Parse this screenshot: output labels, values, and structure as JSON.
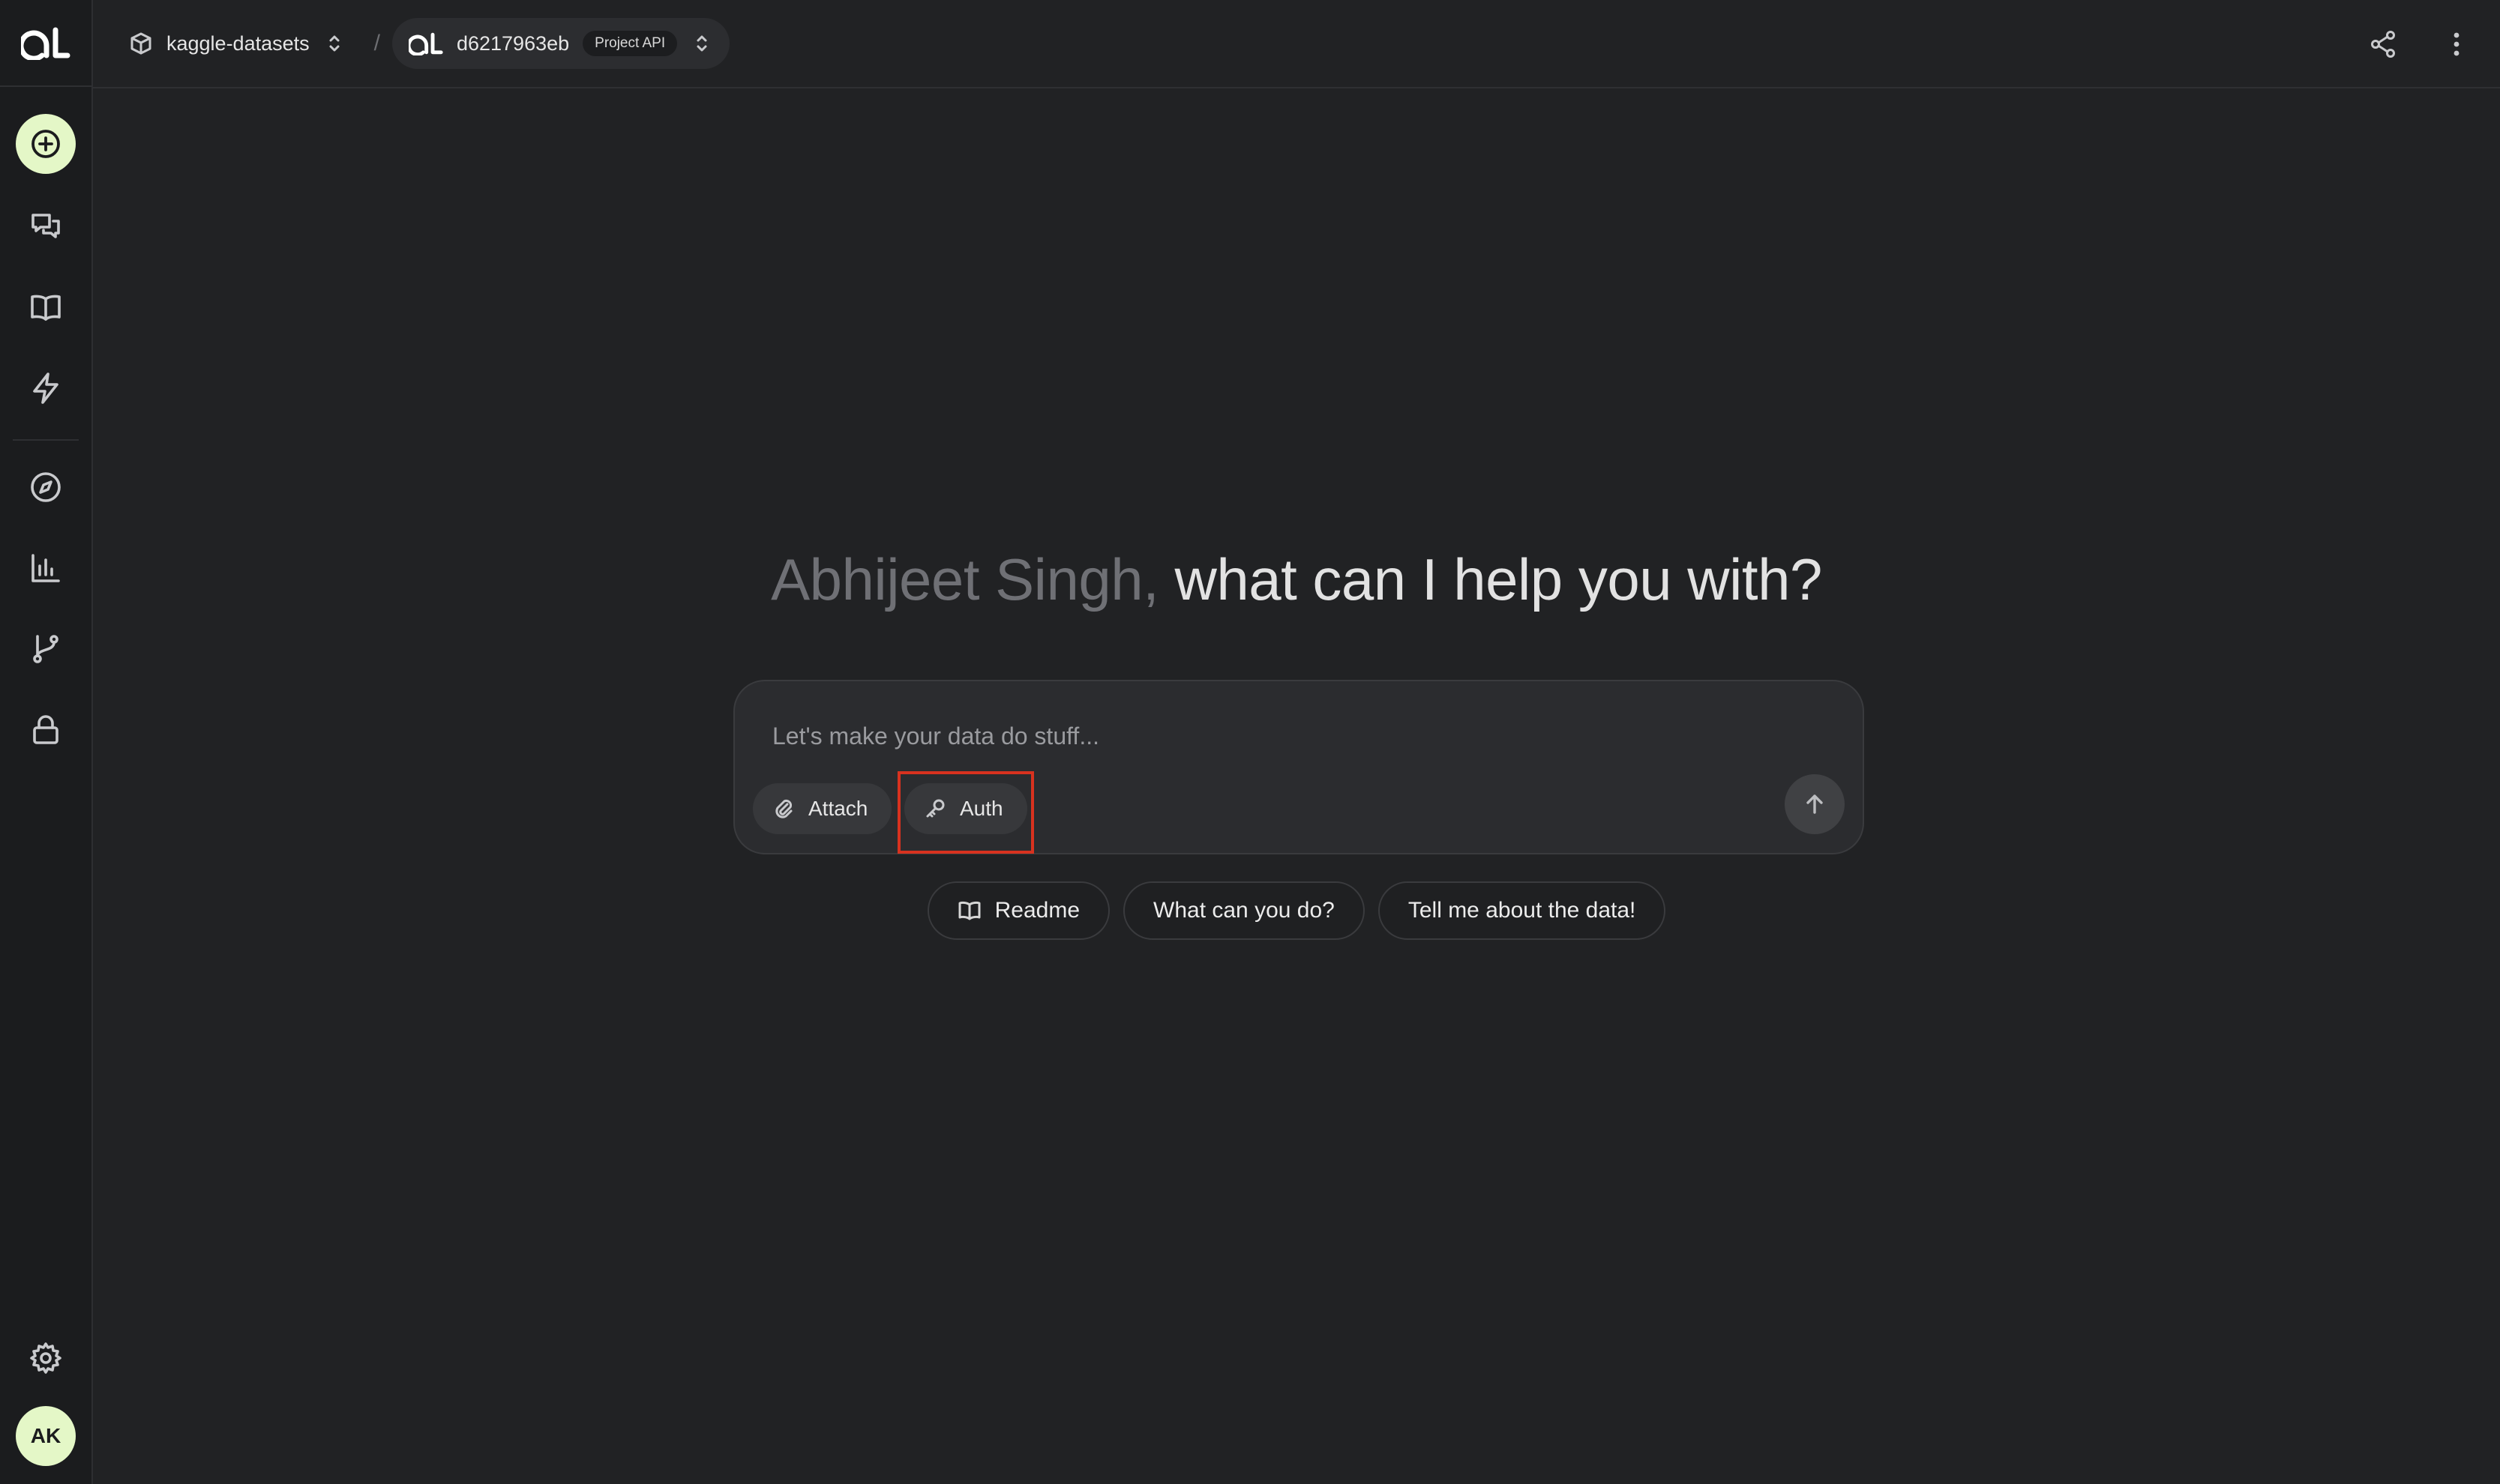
{
  "breadcrumb": {
    "workspace": "kaggle-datasets",
    "separator": "/",
    "project_id": "d6217963eb",
    "project_badge": "Project API"
  },
  "sidebar": {
    "items": [
      {
        "name": "new-chat",
        "icon": "plus-circle-icon"
      },
      {
        "name": "chats",
        "icon": "chat-bubbles-icon"
      },
      {
        "name": "docs",
        "icon": "book-open-icon"
      },
      {
        "name": "actions",
        "icon": "lightning-icon"
      },
      {
        "name": "explore",
        "icon": "compass-icon"
      },
      {
        "name": "analytics",
        "icon": "bar-chart-icon"
      },
      {
        "name": "branches",
        "icon": "git-branch-icon"
      },
      {
        "name": "security",
        "icon": "lock-icon"
      }
    ],
    "avatar_initials": "AK"
  },
  "greeting": {
    "name": "Abhijeet Singh,",
    "rest": "what can I help you with?"
  },
  "prompt": {
    "placeholder": "Let's make your data do stuff...",
    "attach_label": "Attach",
    "auth_label": "Auth"
  },
  "suggestions": [
    {
      "label": "Readme",
      "icon": "book-open-icon"
    },
    {
      "label": "What can you do?"
    },
    {
      "label": "Tell me about the data!"
    }
  ],
  "colors": {
    "background": "#212224",
    "accent": "#e4f7c7",
    "highlight": "#d8321f"
  }
}
